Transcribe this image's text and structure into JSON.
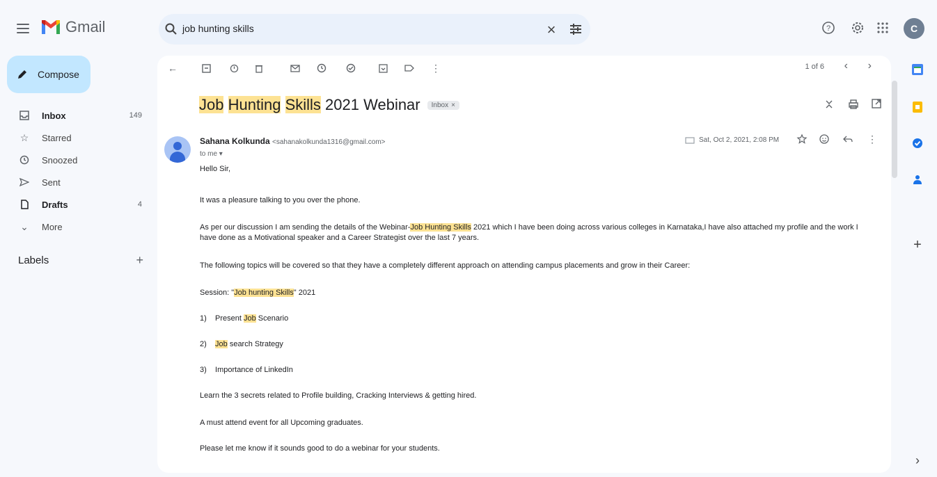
{
  "app": {
    "name": "Gmail"
  },
  "search": {
    "query": "job hunting skills"
  },
  "compose": {
    "label": "Compose"
  },
  "nav": {
    "items": [
      {
        "label": "Inbox",
        "count": "149"
      },
      {
        "label": "Starred",
        "count": ""
      },
      {
        "label": "Snoozed",
        "count": ""
      },
      {
        "label": "Sent",
        "count": ""
      },
      {
        "label": "Drafts",
        "count": "4"
      },
      {
        "label": "More",
        "count": ""
      }
    ],
    "labels_title": "Labels"
  },
  "toolbar": {
    "pager": "1 of 6"
  },
  "email": {
    "subject_parts": [
      "Job",
      "Hunting",
      "Skills",
      "2021 Webinar"
    ],
    "chip": "Inbox",
    "sender_name": "Sahana Kolkunda",
    "sender_email": "<sahanakolkunda1316@gmail.com>",
    "to": "to me",
    "date": "Sat, Oct 2, 2021, 2:08 PM",
    "greeting": "Hello Sir,",
    "p1": "It was a pleasure talking to you over the phone.",
    "p2_a": "As per our discussion  I am sending the details of the Webinar-",
    "p2_hl": "Job Hunting Skills",
    "p2_b": " 2021 which I have been doing across various colleges in Karnataka,I have also attached my profile and the work I",
    "p2_c": "have done as a Motivational speaker and a Career Strategist over the last 7 years.",
    "p3": "The following topics will be covered so that they have a completely different approach on attending campus placements and grow in their Career:",
    "session_a": "Session: \"",
    "session_hl": "Job hunting Skills",
    "session_b": "\" 2021",
    "li1_num": "1)",
    "li1_a": "Present ",
    "li1_hl": "Job",
    "li1_b": " Scenario",
    "li2_num": "2)",
    "li2_hl": "Job",
    "li2_b": " search Strategy",
    "li3_num": "3)",
    "li3": "Importance of LinkedIn",
    "p4": "Learn the 3 secrets related to Profile building, Cracking Interviews & getting hired.",
    "p5": "A must attend event for all Upcoming graduates.",
    "p6": "Please let me know if it sounds good to do a webinar for your students."
  },
  "user": {
    "avatar_letter": "C"
  },
  "colors": {
    "highlight": "#fde293",
    "compose_bg": "#c2e7ff",
    "search_bg": "#eaf1fb"
  }
}
